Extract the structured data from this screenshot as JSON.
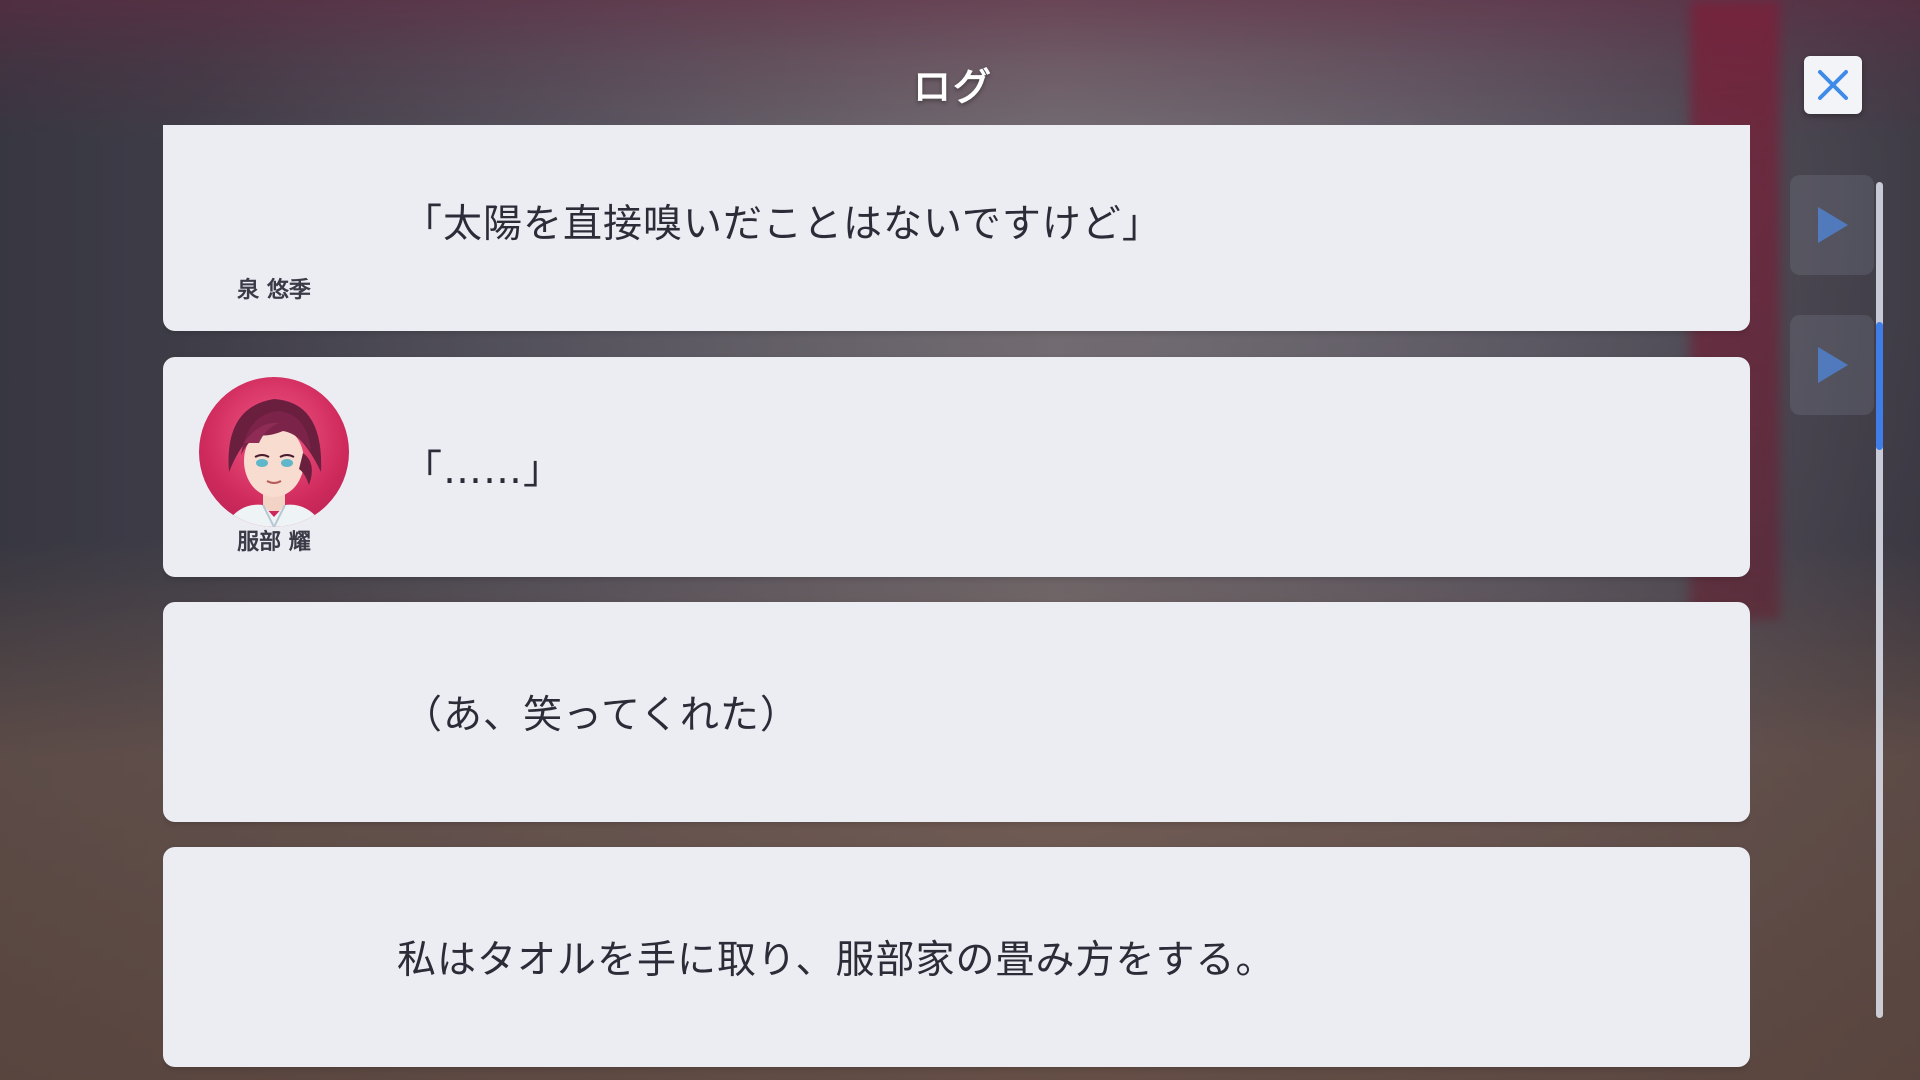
{
  "header": {
    "title": "ログ"
  },
  "close_button": {
    "icon": "close-icon",
    "color": "#3f8be8"
  },
  "entries": [
    {
      "speaker": "泉 悠季",
      "text": "「太陽を直接嗅いだことはないですけど」",
      "has_avatar": false
    },
    {
      "speaker": "服部 耀",
      "text": "「……」",
      "has_avatar": true,
      "avatar_color": "#d9336a"
    },
    {
      "speaker": "",
      "text": "（あ、笑ってくれた）",
      "has_avatar": false
    },
    {
      "speaker": "",
      "text": "私はタオルを手に取り、服部家の畳み方をする。",
      "has_avatar": false
    }
  ],
  "side_buttons": [
    {
      "icon": "play-icon"
    },
    {
      "icon": "play-icon"
    }
  ],
  "colors": {
    "entry_bg": "#ecedf3",
    "accent": "#3f7ee8"
  }
}
